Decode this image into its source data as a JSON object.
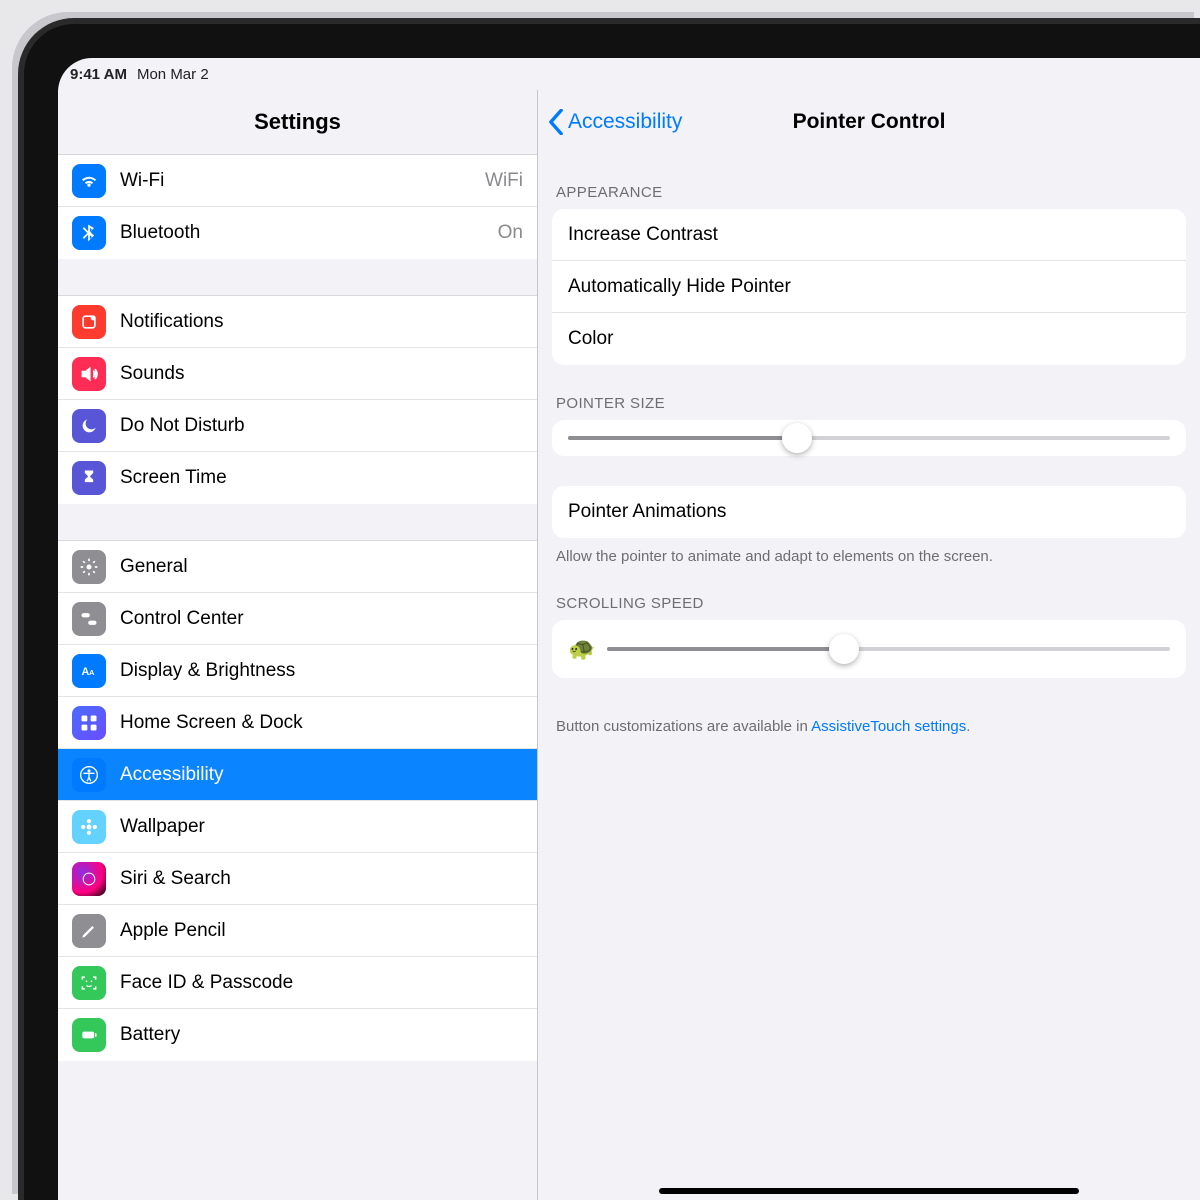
{
  "status": {
    "time": "9:41 AM",
    "date": "Mon Mar 2"
  },
  "sidebar": {
    "title": "Settings",
    "groups": [
      [
        {
          "id": "wifi",
          "label": "Wi-Fi",
          "value": "WiFi",
          "icon": "wifi-icon",
          "color": "ic-blue"
        },
        {
          "id": "bluetooth",
          "label": "Bluetooth",
          "value": "On",
          "icon": "bluetooth-icon",
          "color": "ic-blue"
        }
      ],
      [
        {
          "id": "notifications",
          "label": "Notifications",
          "icon": "bell-icon",
          "color": "ic-red"
        },
        {
          "id": "sounds",
          "label": "Sounds",
          "icon": "speaker-icon",
          "color": "ic-pink"
        },
        {
          "id": "dnd",
          "label": "Do Not Disturb",
          "icon": "moon-icon",
          "color": "ic-purple"
        },
        {
          "id": "screentime",
          "label": "Screen Time",
          "icon": "hourglass-icon",
          "color": "ic-purple"
        }
      ],
      [
        {
          "id": "general",
          "label": "General",
          "icon": "gear-icon",
          "color": "ic-gray"
        },
        {
          "id": "controlcenter",
          "label": "Control Center",
          "icon": "switches-icon",
          "color": "ic-gray"
        },
        {
          "id": "display",
          "label": "Display & Brightness",
          "icon": "text-size-icon",
          "color": "ic-blue"
        },
        {
          "id": "home",
          "label": "Home Screen & Dock",
          "icon": "grid-icon",
          "color": "ic-home"
        },
        {
          "id": "accessibility",
          "label": "Accessibility",
          "icon": "accessibility-icon",
          "color": "ic-blue",
          "selected": true
        },
        {
          "id": "wallpaper",
          "label": "Wallpaper",
          "icon": "flower-icon",
          "color": "ic-teal"
        },
        {
          "id": "siri",
          "label": "Siri & Search",
          "icon": "siri-icon",
          "color": "ic-siri"
        },
        {
          "id": "pencil",
          "label": "Apple Pencil",
          "icon": "pencil-icon",
          "color": "ic-gray"
        },
        {
          "id": "faceid",
          "label": "Face ID & Passcode",
          "icon": "faceid-icon",
          "color": "ic-green"
        },
        {
          "id": "battery",
          "label": "Battery",
          "icon": "battery-icon",
          "color": "ic-green"
        }
      ]
    ]
  },
  "detail": {
    "back_label": "Accessibility",
    "title": "Pointer Control",
    "sections": {
      "appearance": {
        "label": "APPEARANCE",
        "rows": [
          {
            "id": "increase-contrast",
            "label": "Increase Contrast"
          },
          {
            "id": "auto-hide",
            "label": "Automatically Hide Pointer"
          },
          {
            "id": "color",
            "label": "Color"
          }
        ]
      },
      "pointer_size": {
        "label": "POINTER SIZE",
        "value": 38
      },
      "pointer_animations": {
        "row_label": "Pointer Animations",
        "footer": "Allow the pointer to animate and adapt to elements on the screen."
      },
      "scrolling_speed": {
        "label": "SCROLLING SPEED",
        "value": 42
      },
      "footer": {
        "prefix": "Button customizations are available in ",
        "link": "AssistiveTouch settings",
        "suffix": "."
      }
    }
  }
}
